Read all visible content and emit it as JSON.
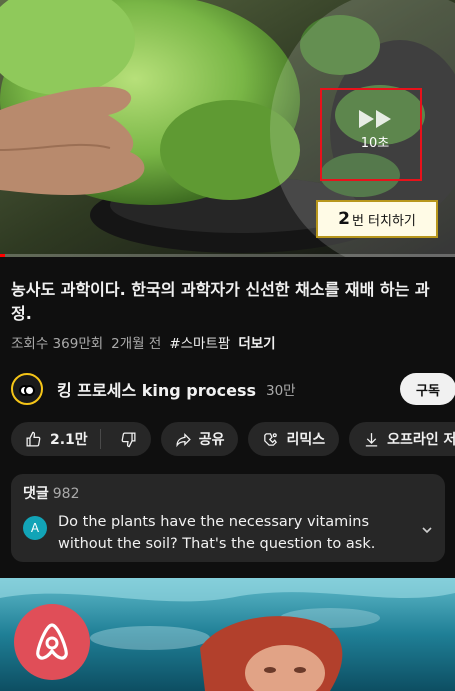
{
  "video": {
    "seek_label": "10초",
    "tip": {
      "number": "2",
      "text": "번 터치하기"
    },
    "progress": 0.01,
    "title": "농사도 과학이다. 한국의 과학자가 신선한 채소를 재배 하는 과정.",
    "views": "조회수 369만회",
    "uploaded": "2개월 전",
    "hashtag": "#스마트팜",
    "more": "더보기"
  },
  "channel": {
    "name": "킹 프로세스 king process",
    "subscribers": "30만",
    "subscribe_label": "구독"
  },
  "actions": {
    "likes": "2.1만",
    "share": "공유",
    "remix": "리믹스",
    "download": "오프라인 저장"
  },
  "comments": {
    "label": "댓글",
    "count": "982",
    "top_avatar": "A",
    "top_text": "Do the plants have the necessary vitamins without the soil? That's the question to ask."
  },
  "colors": {
    "background": "#0f0f0f",
    "chip": "#272727",
    "progress": "#ff0000",
    "highlight_box": "#e8121b",
    "comment_avatar": "#12a4b7",
    "airbnb": "#e04e58"
  },
  "icons": [
    "skip-forward-icon",
    "like-icon",
    "dislike-icon",
    "share-icon",
    "remix-icon",
    "download-icon",
    "chevron-down-icon",
    "airbnb-logo-icon"
  ]
}
